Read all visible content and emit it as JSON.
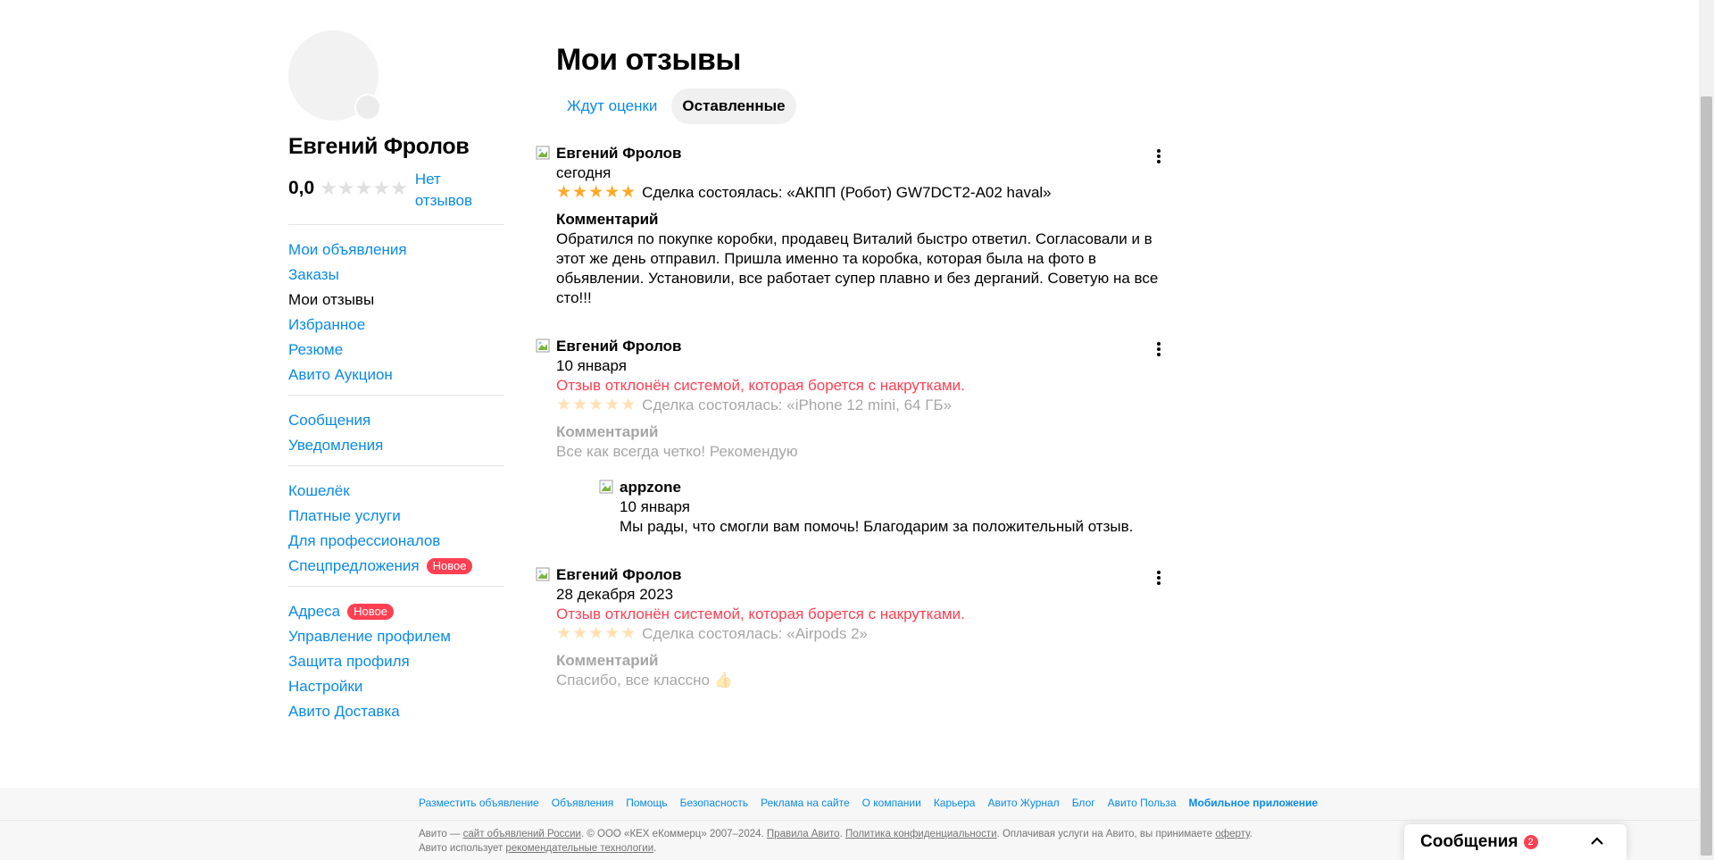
{
  "profile": {
    "name": "Евгений Фролов",
    "rating": "0,0",
    "no_reviews": "Нет отзывов"
  },
  "nav": {
    "group1": [
      {
        "label": "Мои объявления"
      },
      {
        "label": "Заказы"
      },
      {
        "label": "Мои отзывы"
      },
      {
        "label": "Избранное"
      },
      {
        "label": "Резюме"
      },
      {
        "label": "Авито Аукцион"
      }
    ],
    "group2": [
      {
        "label": "Сообщения"
      },
      {
        "label": "Уведомления"
      }
    ],
    "group3": [
      {
        "label": "Кошелёк"
      },
      {
        "label": "Платные услуги"
      },
      {
        "label": "Для профессионалов"
      },
      {
        "label": "Спецпредложения",
        "badge": "Новое"
      }
    ],
    "group4": [
      {
        "label": "Адреса",
        "badge": "Новое"
      },
      {
        "label": "Управление профилем"
      },
      {
        "label": "Защита профиля"
      },
      {
        "label": "Настройки"
      },
      {
        "label": "Авито Доставка"
      }
    ]
  },
  "main": {
    "title": "Мои отзывы",
    "tabs": [
      {
        "label": "Ждут оценки"
      },
      {
        "label": "Оставленные"
      }
    ]
  },
  "reviews": [
    {
      "author": "Евгений Фролов",
      "date": "сегодня",
      "deal": "Сделка состоялась: «АКПП (Робот) GW7DCT2-A02 haval»",
      "comment_heading": "Комментарий",
      "comment": "Обратился по покупке коробки, продавец Виталий быстро ответил. Согласовали и в этот же день отправил. Пришла именно та коробка, которая была на фото в обьявлении. Установили, все работает супер плавно и без дерганий. Советую на все сто!!!"
    },
    {
      "author": "Евгений Фролов",
      "date": "10 января",
      "rejected": "Отзыв отклонён системой, которая борется с накрутками.",
      "deal": "Сделка состоялась: «iPhone 12 mini, 64 ГБ»",
      "comment_heading": "Комментарий",
      "comment": "Все как всегда четко! Рекомендую",
      "answer": {
        "author": "appzone",
        "date": "10 января",
        "text": "Мы рады, что смогли вам помочь! Благодарим за положительный отзыв."
      }
    },
    {
      "author": "Евгений Фролов",
      "date": "28 декабря 2023",
      "rejected": "Отзыв отклонён системой, которая борется с накрутками.",
      "deal": "Сделка состоялась: «Airpods 2»",
      "comment_heading": "Комментарий",
      "comment": "Спасибо, все классно 👍"
    }
  ],
  "footer": {
    "links": [
      "Разместить объявление",
      "Объявления",
      "Помощь",
      "Безопасность",
      "Реклама на сайте",
      "О компании",
      "Карьера",
      "Авито Журнал",
      "Блог",
      "Авито Польза",
      "Мобильное приложение"
    ],
    "legal_1": "Авито — ",
    "legal_link_1": "сайт объявлений России",
    "legal_2": ". © ООО «КЕХ еКоммерц» 2007–2024. ",
    "legal_link_2": "Правила Авито",
    "legal_3": ". ",
    "legal_link_3": "Политика конфиденциальности",
    "legal_4": ". Оплачивая услуги на Авито, вы принимаете ",
    "legal_link_4": "оферту",
    "legal_5": ". Авито использует ",
    "legal_link_5": "рекомендательные технологии",
    "legal_6": "."
  },
  "messages": {
    "title": "Сообщения",
    "count": "2"
  },
  "colors": {
    "accent": "#0a8ae8",
    "danger": "#ff4053",
    "star": "#ffa928"
  },
  "icons": {
    "stars": "star-icon",
    "more": "more-vertical-icon",
    "chevron": "chevron-up-icon",
    "broken_image": "broken-image-icon"
  }
}
